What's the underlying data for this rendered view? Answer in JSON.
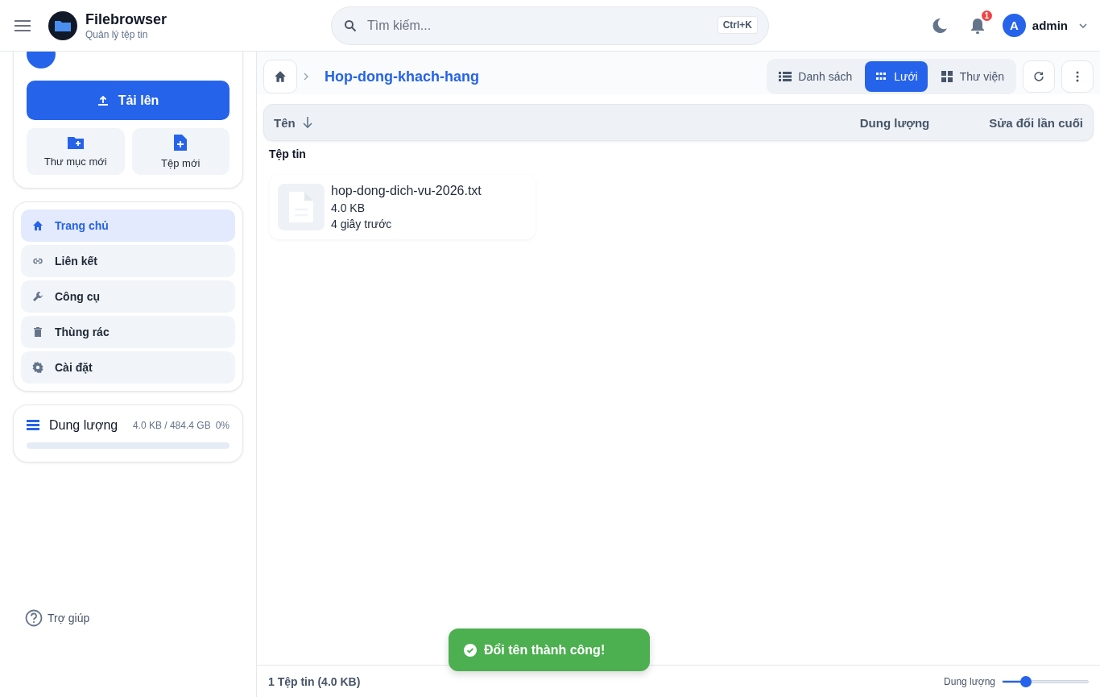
{
  "header": {
    "app_name": "Filebrowser",
    "app_subtitle": "Quản lý tệp tin",
    "search": {
      "placeholder": "Tìm kiếm...",
      "shortcut": "Ctrl+K"
    },
    "notifications": {
      "badge": "1"
    },
    "user": {
      "avatar_letter": "A",
      "name": "admin"
    }
  },
  "sidebar": {
    "upload_button": "Tải lên",
    "quick_actions": [
      {
        "label": "Thư mục mới",
        "kind": "folder"
      },
      {
        "label": "Tệp mới",
        "kind": "file"
      }
    ],
    "nav": [
      {
        "label": "Trang chủ",
        "kind": "home",
        "selected": true
      },
      {
        "label": "Liên kết",
        "kind": "link",
        "selected": false
      },
      {
        "label": "Công cụ",
        "kind": "tools",
        "selected": false
      },
      {
        "label": "Thùng rác",
        "kind": "trash",
        "selected": false
      },
      {
        "label": "Cài đặt",
        "kind": "settings",
        "selected": false
      }
    ],
    "storage": {
      "label": "Dung lượng",
      "usage": "4.0 KB / 484.4 GB",
      "percent": "0%",
      "level": 0
    },
    "help": "Trợ giúp"
  },
  "toolbar": {
    "current_folder": "Hop-dong-khach-hang",
    "view_modes": [
      {
        "label": "Danh sách",
        "kind": "list",
        "selected": false
      },
      {
        "label": "Lưới",
        "kind": "grid",
        "selected": true
      },
      {
        "label": "Thư viện",
        "kind": "gallery",
        "selected": false
      }
    ]
  },
  "columns": [
    {
      "label": "Tên",
      "sorted": true
    },
    {
      "label": "Dung lượng",
      "sorted": false
    },
    {
      "label": "Sửa đổi lần cuối",
      "sorted": false
    }
  ],
  "section_label": "Tệp tin",
  "files": [
    {
      "name": "hop-dong-dich-vu-2026.txt",
      "size": "4.0 KB",
      "modified": "4 giây trước"
    }
  ],
  "toast": {
    "message": "Đổi tên thành công!"
  },
  "status_bar": {
    "summary": "1 Tệp tin (4.0 KB)",
    "size_label": "Dung lượng",
    "level": 0.28
  }
}
